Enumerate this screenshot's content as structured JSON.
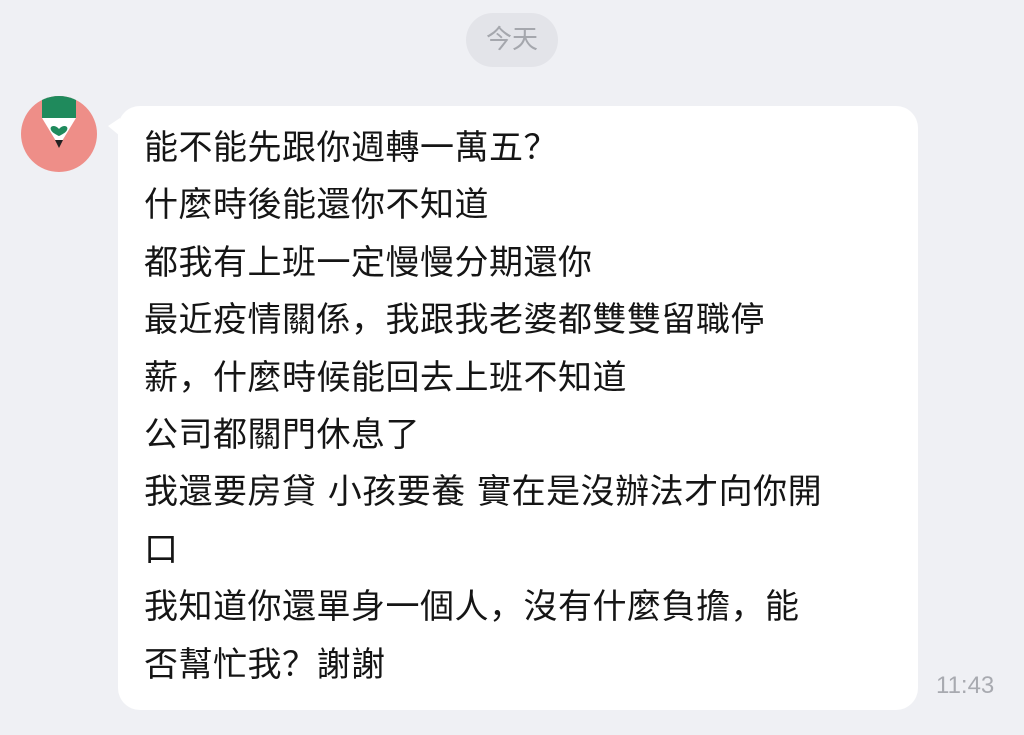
{
  "date_separator": "今天",
  "contact": {
    "avatar_icon": "pencil-heart-icon",
    "avatar_color": "#ee8e88"
  },
  "message": {
    "lines": [
      "能不能先跟你週轉一萬五？",
      "什麼時後能還你不知道",
      "都我有上班一定慢慢分期還你",
      "最近疫情關係，我跟我老婆都雙雙留職停",
      "薪，什麼時候能回去上班不知道",
      "公司都關門休息了",
      "我還要房貸 小孩要養 實在是沒辦法才向你開",
      "口",
      "我知道你還單身一個人，沒有什麼負擔，能",
      "否幫忙我？謝謝"
    ],
    "time": "11:43"
  }
}
